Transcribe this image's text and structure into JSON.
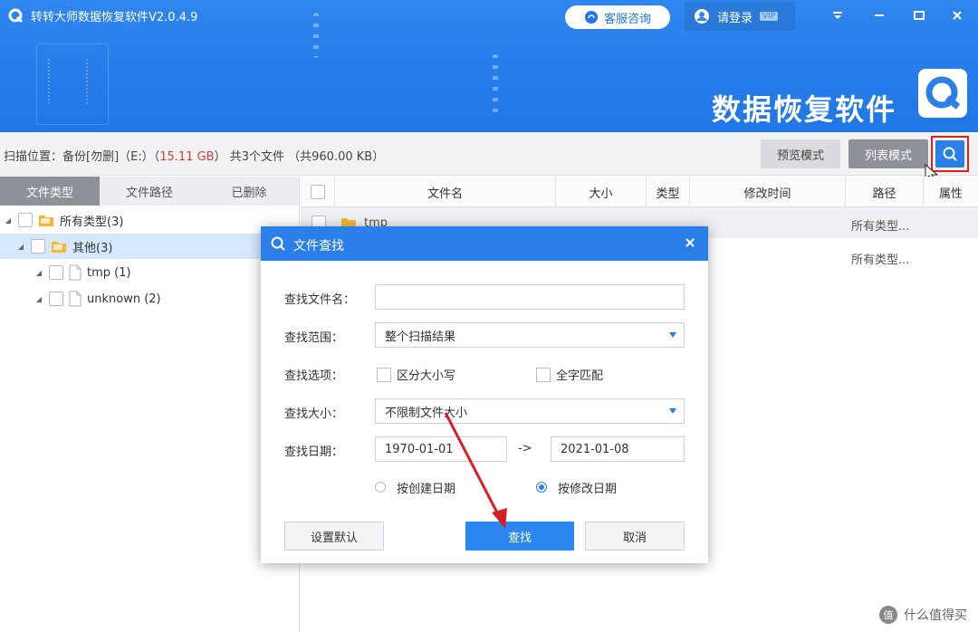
{
  "app": {
    "title": "转转大师数据恢复软件V2.0.4.9",
    "brand": "数据恢复软件",
    "customer_service": "客服咨询",
    "login": "请登录",
    "vip": "VIP"
  },
  "infobar": {
    "scan_prefix": "扫描位置：备份[勿删]（E:）（",
    "scan_size": "15.11 GB",
    "scan_suffix": "） 共3个文件 （共960.00 KB）",
    "preview_mode": "预览模式",
    "list_mode": "列表模式"
  },
  "left_tabs": [
    "文件类型",
    "文件路径",
    "已删除"
  ],
  "tree": [
    {
      "label": "所有类型(3)"
    },
    {
      "label": "其他(3)"
    },
    {
      "label": "tmp (1)"
    },
    {
      "label": "unknown (2)"
    }
  ],
  "table": {
    "columns": [
      "文件名",
      "大小",
      "类型",
      "修改时间",
      "路径",
      "属性"
    ],
    "rows": [
      {
        "name": "tmp",
        "path": "所有类型..."
      },
      {
        "name": "",
        "path": "所有类型..."
      }
    ]
  },
  "dialog": {
    "title": "文件查找",
    "filename_label": "查找文件名：",
    "filename_value": "",
    "scope_label": "查找范围：",
    "scope_value": "整个扫描结果",
    "options_label": "查找选项：",
    "case_sensitive": "区分大小写",
    "whole_word": "全字匹配",
    "size_label": "查找大小：",
    "size_value": "不限制文件大小",
    "date_label": "查找日期：",
    "date_from": "1970-01-01",
    "date_sep": "->",
    "date_to": "2021-01-08",
    "by_created": "按创建日期",
    "by_modified": "按修改日期",
    "set_default": "设置默认",
    "search": "查找",
    "cancel": "取消"
  },
  "watermark": "什么值得买",
  "colors": {
    "header_blue": "#1f76e6",
    "accent_blue": "#2b7fe8",
    "highlight_red": "#e02020",
    "size_red": "#e03a3a"
  }
}
